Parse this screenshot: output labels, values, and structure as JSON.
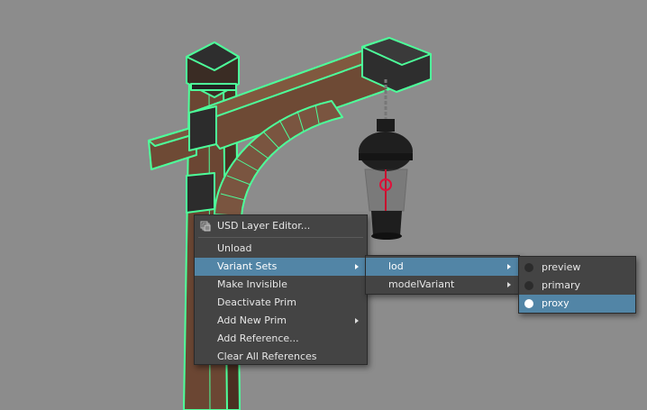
{
  "scene": {
    "background": "#8c8c8c",
    "selection_color": "#4dff9a",
    "wood_color": "#6e4a35",
    "lantern_color": "#1f1f1f"
  },
  "context_menu": {
    "items": [
      {
        "label": "USD Layer Editor...",
        "icon": "usd-layer-icon"
      },
      {
        "label": "Unload"
      },
      {
        "label": "Variant Sets",
        "has_submenu": true,
        "highlighted": true
      },
      {
        "label": "Make Invisible"
      },
      {
        "label": "Deactivate Prim"
      },
      {
        "label": "Add New Prim",
        "has_submenu": true
      },
      {
        "label": "Add Reference..."
      },
      {
        "label": "Clear All References"
      }
    ]
  },
  "variant_sets_menu": {
    "items": [
      {
        "label": "lod",
        "has_submenu": true,
        "highlighted": true
      },
      {
        "label": "modelVariant",
        "has_submenu": true
      }
    ]
  },
  "lod_menu": {
    "items": [
      {
        "label": "preview",
        "selected": false
      },
      {
        "label": "primary",
        "selected": false
      },
      {
        "label": "proxy",
        "selected": true,
        "highlighted": true
      }
    ]
  },
  "colors": {
    "menu_bg": "#444444",
    "highlight": "#5285a6",
    "text": "#e6e6e6"
  }
}
